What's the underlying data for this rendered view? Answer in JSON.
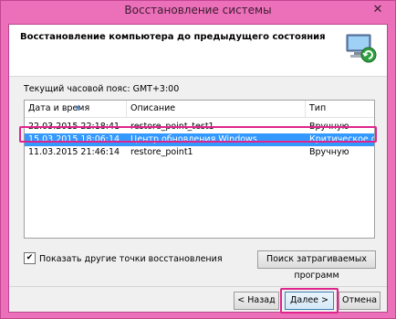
{
  "window": {
    "title": "Восстановление системы",
    "close_glyph": "✕"
  },
  "header": {
    "title": "Восстановление компьютера до предыдущего состояния",
    "icon": "system-restore-icon"
  },
  "timezone": {
    "label": "Текущий часовой пояс: GMT+3:00"
  },
  "table": {
    "columns": [
      "Дата и время",
      "Описание",
      "Тип"
    ],
    "rows": [
      {
        "date": "22.03.2015 22:18:41",
        "description": "restore_point_test1",
        "type": "Вручную",
        "selected": false
      },
      {
        "date": "15.03.2015 18:06:14",
        "description": "Центр обновления Windows",
        "type": "Критическое о...",
        "selected": true
      },
      {
        "date": "11.03.2015 21:46:14",
        "description": "restore_point1",
        "type": "Вручную",
        "selected": false
      }
    ]
  },
  "show_more": {
    "label": "Показать другие точки восстановления",
    "checked": true,
    "check_glyph": "✔"
  },
  "buttons": {
    "affected_programs": "Поиск затрагиваемых программ",
    "back": "< Назад",
    "next": "Далее >",
    "cancel": "Отмена"
  },
  "colors": {
    "frame": "#ec6fb9",
    "selection": "#3399ff",
    "highlight": "#e0248d"
  }
}
